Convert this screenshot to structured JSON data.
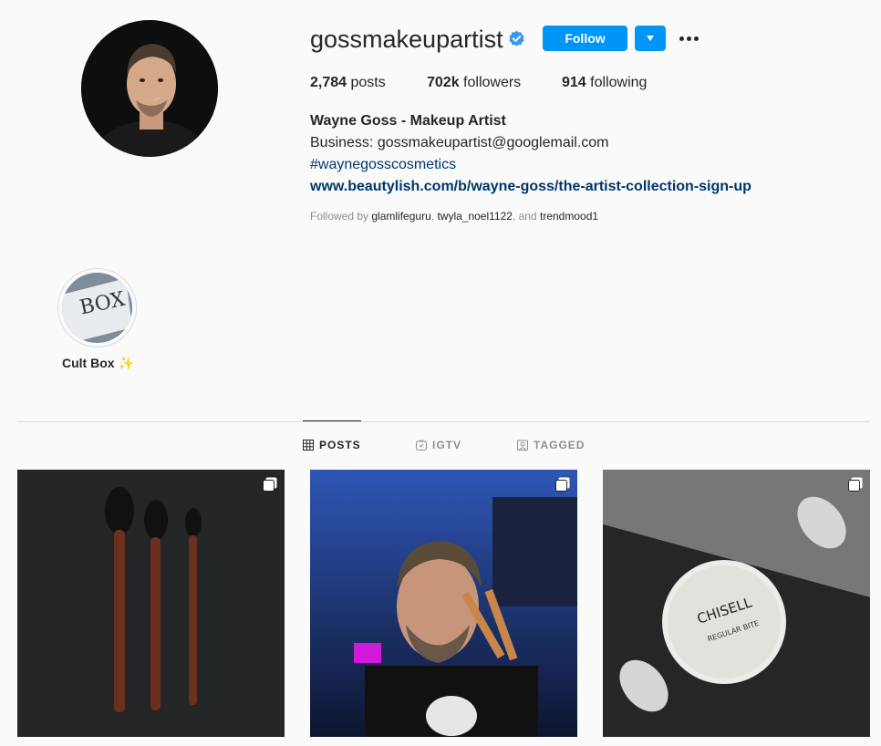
{
  "profile": {
    "username": "gossmakeupartist",
    "follow_label": "Follow",
    "stats": {
      "posts_count": "2,784",
      "posts_label": "posts",
      "followers_count": "702k",
      "followers_label": "followers",
      "following_count": "914",
      "following_label": "following"
    },
    "full_name": "Wayne Goss - Makeup Artist",
    "bio_business": "Business: gossmakeupartist@googlemail.com",
    "bio_hashtag": "#waynegosscosmetics",
    "website": "www.beautylish.com/b/wayne-goss/the-artist-collection-sign-up",
    "followed_by_prefix": "Followed by",
    "followed_by": [
      "glamlifeguru",
      "twyla_noel1122",
      "trendmood1"
    ],
    "followed_by_sep": ",",
    "followed_by_and": ", and"
  },
  "highlights": [
    {
      "label": "Cult Box ✨",
      "image_text": "BOX"
    }
  ],
  "tabs": [
    {
      "label": "POSTS",
      "icon": "grid-icon",
      "active": true
    },
    {
      "label": "IGTV",
      "icon": "igtv-icon",
      "active": false
    },
    {
      "label": "TAGGED",
      "icon": "tagged-icon",
      "active": false
    }
  ],
  "posts": [
    {
      "subject": "makeup brushes",
      "multi": true
    },
    {
      "subject": "man holding brushes",
      "multi": true
    },
    {
      "subject": "compact",
      "compact_brand": "CHISELL",
      "compact_sub": "REGULAR BITE",
      "multi": true
    }
  ],
  "colors": {
    "accent": "#0095f6",
    "link": "#00376b",
    "muted": "#8e8e8e"
  }
}
